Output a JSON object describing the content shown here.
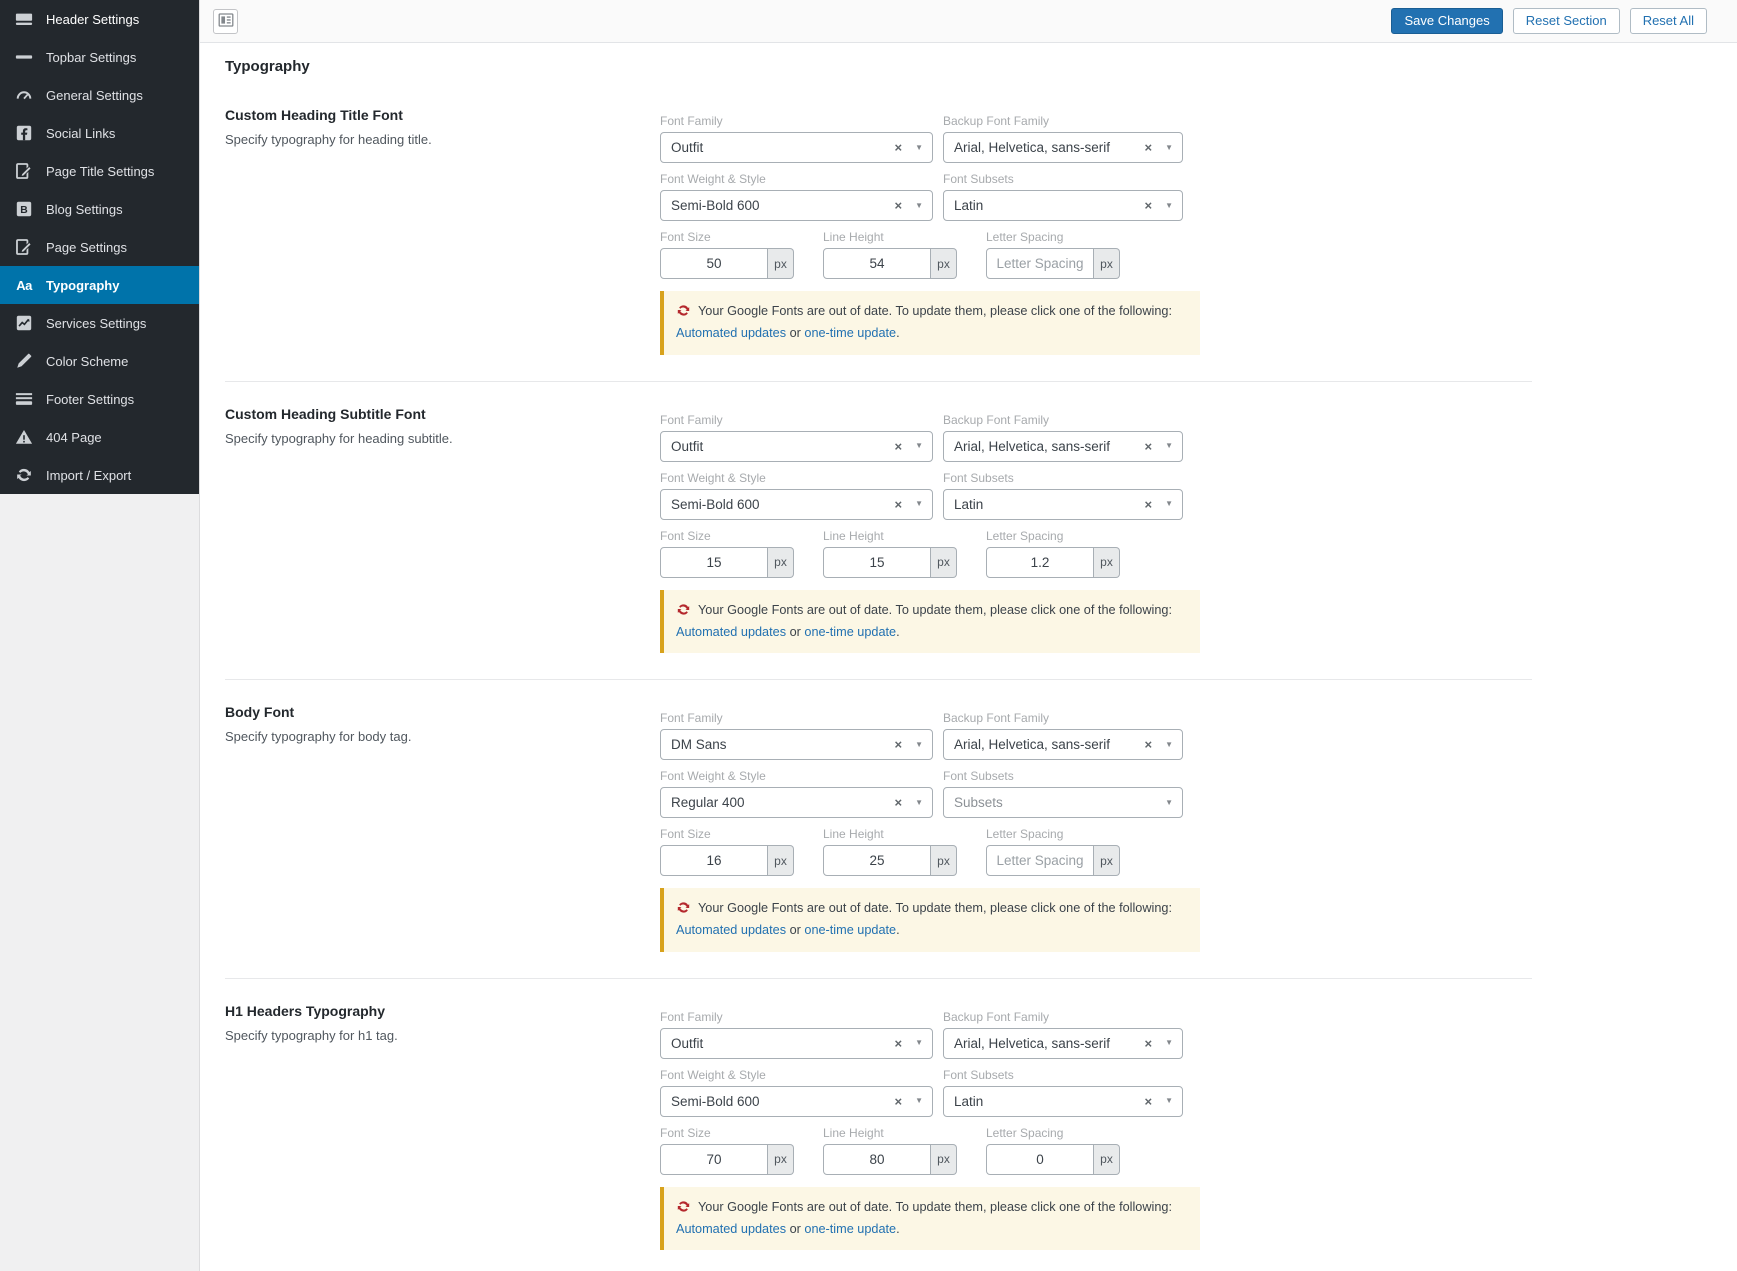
{
  "sidebar": {
    "items": [
      {
        "label": "Header Settings",
        "icon": "header-icon",
        "active": false
      },
      {
        "label": "Topbar Settings",
        "icon": "topbar-icon",
        "active": false
      },
      {
        "label": "General Settings",
        "icon": "dashboard-icon",
        "active": false
      },
      {
        "label": "Social Links",
        "icon": "facebook-icon",
        "active": false
      },
      {
        "label": "Page Title Settings",
        "icon": "page-edit-icon",
        "active": false
      },
      {
        "label": "Blog Settings",
        "icon": "blogger-icon",
        "active": false
      },
      {
        "label": "Page Settings",
        "icon": "page-edit-icon",
        "active": false
      },
      {
        "label": "Typography",
        "icon": "typography-aa-icon",
        "active": true
      },
      {
        "label": "Services Settings",
        "icon": "chart-icon",
        "active": false
      },
      {
        "label": "Color Scheme",
        "icon": "pencil-icon",
        "active": false
      },
      {
        "label": "Footer Settings",
        "icon": "footer-icon",
        "active": false
      },
      {
        "label": "404 Page",
        "icon": "warning-triangle-icon",
        "active": false
      },
      {
        "label": "Import / Export",
        "icon": "sync-icon",
        "active": false
      }
    ]
  },
  "toolbar": {
    "panel_icon": "layout-panel-icon",
    "save_label": "Save Changes",
    "reset_section_label": "Reset Section",
    "reset_all_label": "Reset All"
  },
  "page": {
    "title": "Typography"
  },
  "labels": {
    "font_family": "Font Family",
    "backup_font_family": "Backup Font Family",
    "font_weight_style": "Font Weight & Style",
    "font_subsets": "Font Subsets",
    "font_size": "Font Size",
    "line_height": "Line Height",
    "letter_spacing": "Letter Spacing",
    "subsets_placeholder": "Subsets",
    "px": "px"
  },
  "warning": {
    "icon": "red-sync-icon",
    "text_before": "Your Google Fonts are out of date. To update them, please click one of the following: ",
    "link1": "Automated updates",
    "middle": " or ",
    "link2": "one-time update",
    "suffix": "."
  },
  "sections": [
    {
      "title": "Custom Heading Title Font",
      "description": "Specify typography for heading title.",
      "font_family": "Outfit",
      "backup_font_family": "Arial, Helvetica, sans-serif",
      "font_weight": "Semi-Bold 600",
      "font_subsets": "Latin",
      "font_size": "50",
      "line_height": "54",
      "letter_spacing": ""
    },
    {
      "title": "Custom Heading Subtitle Font",
      "description": "Specify typography for heading subtitle.",
      "font_family": "Outfit",
      "backup_font_family": "Arial, Helvetica, sans-serif",
      "font_weight": "Semi-Bold 600",
      "font_subsets": "Latin",
      "font_size": "15",
      "line_height": "15",
      "letter_spacing": "1.2"
    },
    {
      "title": "Body Font",
      "description": "Specify typography for body tag.",
      "font_family": "DM Sans",
      "backup_font_family": "Arial, Helvetica, sans-serif",
      "font_weight": "Regular 400",
      "font_subsets": "",
      "font_size": "16",
      "line_height": "25",
      "letter_spacing": ""
    },
    {
      "title": "H1 Headers Typography",
      "description": "Specify typography for h1 tag.",
      "font_family": "Outfit",
      "backup_font_family": "Arial, Helvetica, sans-serif",
      "font_weight": "Semi-Bold 600",
      "font_subsets": "Latin",
      "font_size": "70",
      "line_height": "80",
      "letter_spacing": "0"
    }
  ],
  "colors": {
    "sidebar_bg": "#23282d",
    "active_item_blue": "#0073aa",
    "primary_button_blue": "#2271b1",
    "link_blue": "#2271b1",
    "warning_bg": "#fcf7e5",
    "warning_border_gold": "#d8a21c",
    "warning_icon_red": "#b4282d"
  }
}
